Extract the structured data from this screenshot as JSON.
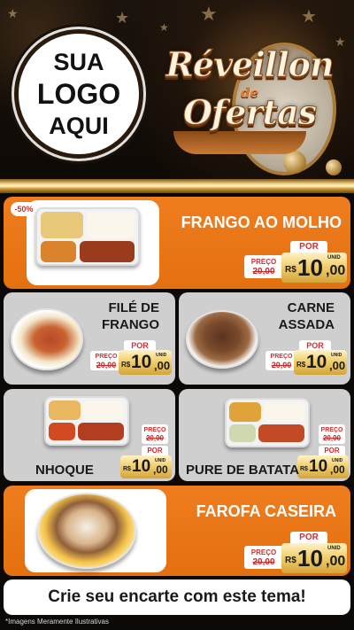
{
  "header": {
    "logo_lines": [
      "SUA",
      "LOGO",
      "AQUI"
    ],
    "campaign": {
      "line1": "Réveillon",
      "de": "de",
      "line2": "Ofertas"
    }
  },
  "products": [
    {
      "name": "FRANGO AO MOLHO",
      "badge": "-50%",
      "price": {
        "por": "POR",
        "preco_label": "PREÇO",
        "old": "20,00",
        "currency": "R$",
        "int": "10",
        "cents": ",00",
        "unit": "UNID"
      }
    },
    {
      "name_lines": [
        "FILÉ DE",
        "FRANGO"
      ],
      "price": {
        "por": "POR",
        "preco_label": "PREÇO",
        "old": "20,00",
        "currency": "R$",
        "int": "10",
        "cents": ",00",
        "unit": "UNID"
      }
    },
    {
      "name_lines": [
        "CARNE",
        "ASSADA"
      ],
      "price": {
        "por": "POR",
        "preco_label": "PREÇO",
        "old": "20,00",
        "currency": "R$",
        "int": "10",
        "cents": ",00",
        "unit": "UNID"
      }
    },
    {
      "name": "NHOQUE",
      "price": {
        "por": "POR",
        "preco_label": "PREÇO",
        "old": "20,00",
        "currency": "R$",
        "int": "10",
        "cents": ",00",
        "unit": "UNID"
      }
    },
    {
      "name": "PURE DE BATATA",
      "price": {
        "por": "POR",
        "preco_label": "PREÇO",
        "old": "20,00",
        "currency": "R$",
        "int": "10",
        "cents": ",00",
        "unit": "UNID"
      }
    },
    {
      "name": "FAROFA CASEIRA",
      "price": {
        "por": "POR",
        "preco_label": "PREÇO",
        "old": "20,00",
        "currency": "R$",
        "int": "10",
        "cents": ",00",
        "unit": "UNID"
      }
    }
  ],
  "cta": "Crie seu encarte com este tema!",
  "disclaimer": "*Imagens Meramente Ilustrativas",
  "colors": {
    "orange": "#ef7d1e",
    "gray_card": "#cfcfcf",
    "gold": "#f2cf6e",
    "red_price": "#d32f2f",
    "background": "#0c0906"
  }
}
